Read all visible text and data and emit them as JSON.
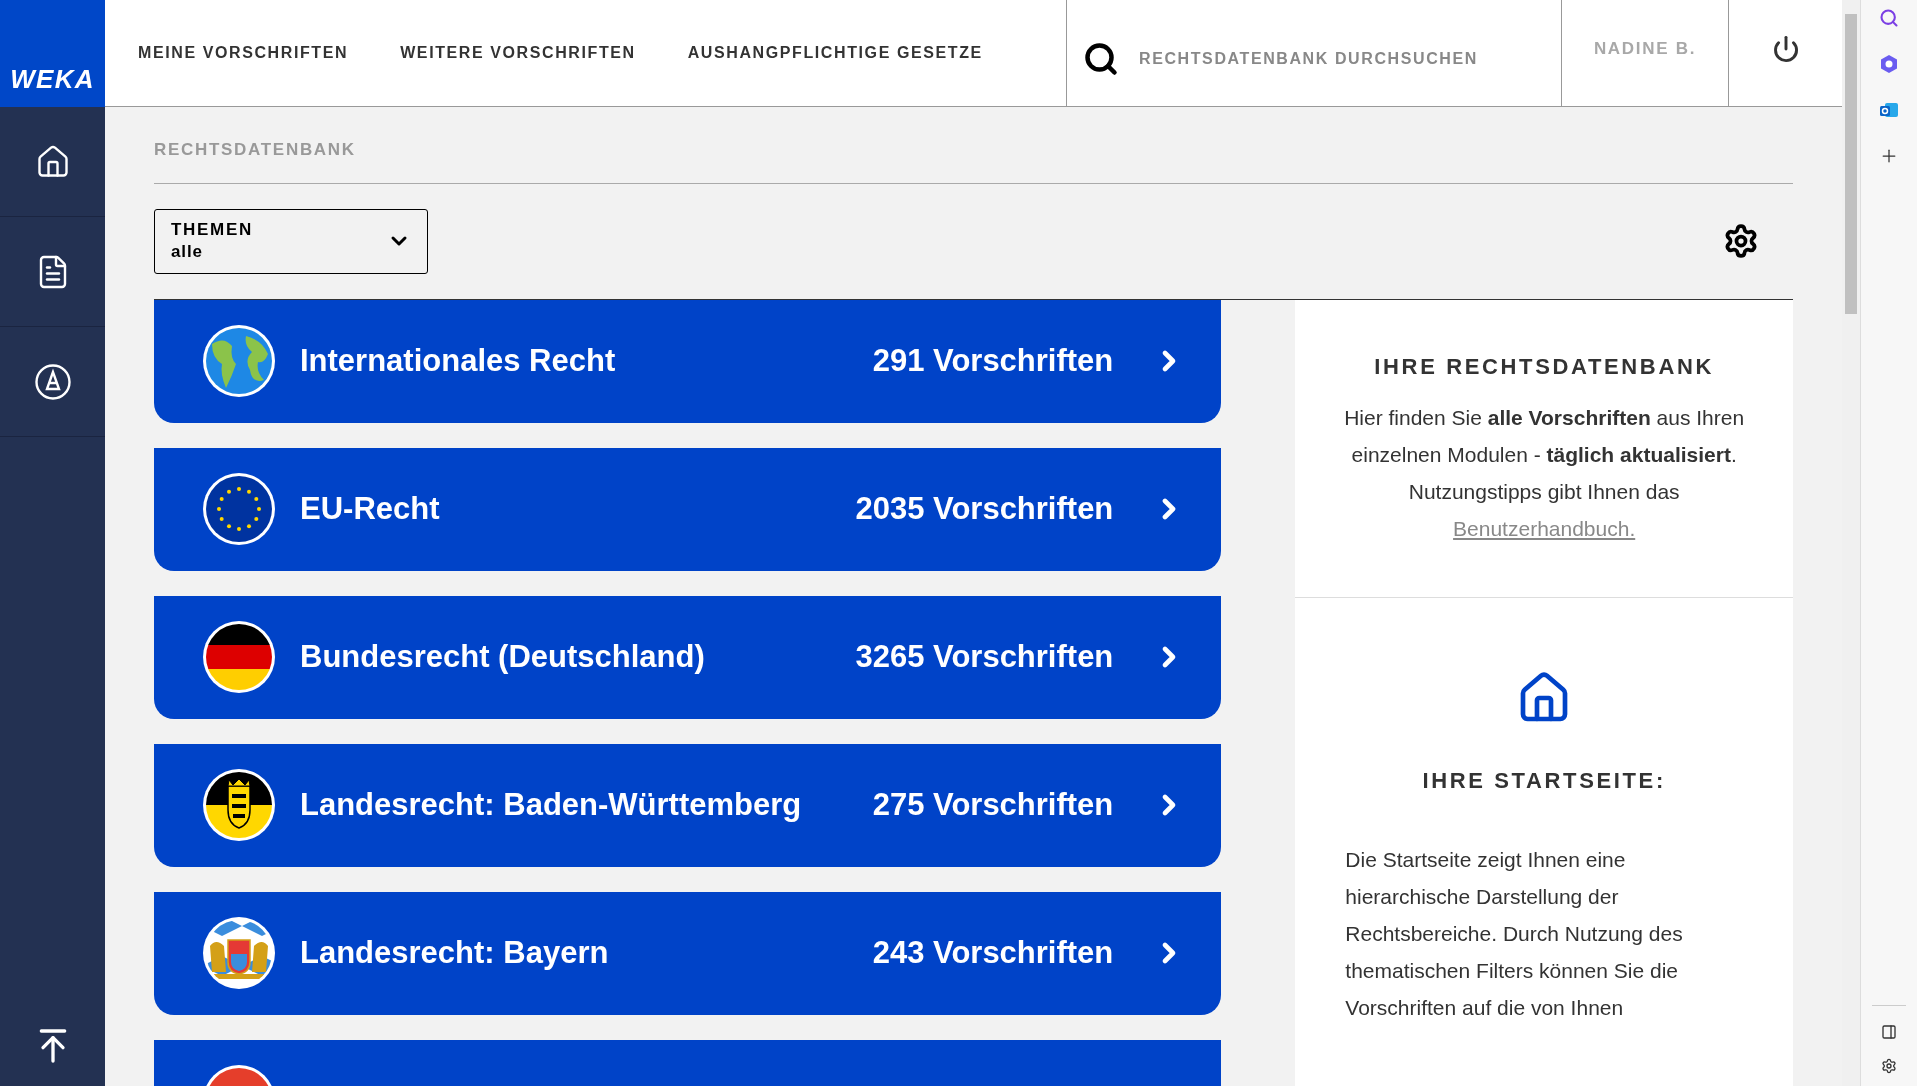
{
  "logo": "WEKA",
  "sidebar": {
    "items": [
      {
        "kind": "home"
      },
      {
        "kind": "document"
      },
      {
        "kind": "warning"
      }
    ]
  },
  "nav": [
    "MEINE VORSCHRIFTEN",
    "WEITERE VORSCHRIFTEN",
    "AUSHANGPFLICHTIGE GESETZE"
  ],
  "search": {
    "placeholder": "RECHTSDATENBANK DURCHSUCHEN"
  },
  "user": "NADINE B.",
  "breadcrumb": "RECHTSDATENBANK",
  "filter": {
    "label": "THEMEN",
    "value": "alle"
  },
  "categories": [
    {
      "kind": "globe",
      "title": "Internationales Recht",
      "count": "291 Vorschriften"
    },
    {
      "kind": "eu",
      "title": "EU-Recht",
      "count": "2035 Vorschriften"
    },
    {
      "kind": "germany",
      "title": "Bundesrecht (Deutschland)",
      "count": "3265 Vorschriften"
    },
    {
      "kind": "bw",
      "title": "Landesrecht: Baden-Württemberg",
      "count": "275 Vorschriften"
    },
    {
      "kind": "bavaria",
      "title": "Landesrecht: Bayern",
      "count": "243 Vorschriften"
    },
    {
      "kind": "red"
    }
  ],
  "info": {
    "title": "IHRE RECHTSDATENBANK",
    "text": "Hier finden Sie **alle Vorschriften** aus Ihren einzelnen Modulen - **täglich aktualisiert**.",
    "tip": "Nutzungstipps gibt Ihnen das",
    "link": "Benutzerhandbuch."
  },
  "start": {
    "title": "IHRE STARTSEITE:",
    "text": "Die Startseite zeigt Ihnen eine hierarchische Darstellung der Rechtsbereiche. Durch Nutzung des thematischen Filters können Sie die Vorschriften auf die von Ihnen"
  }
}
